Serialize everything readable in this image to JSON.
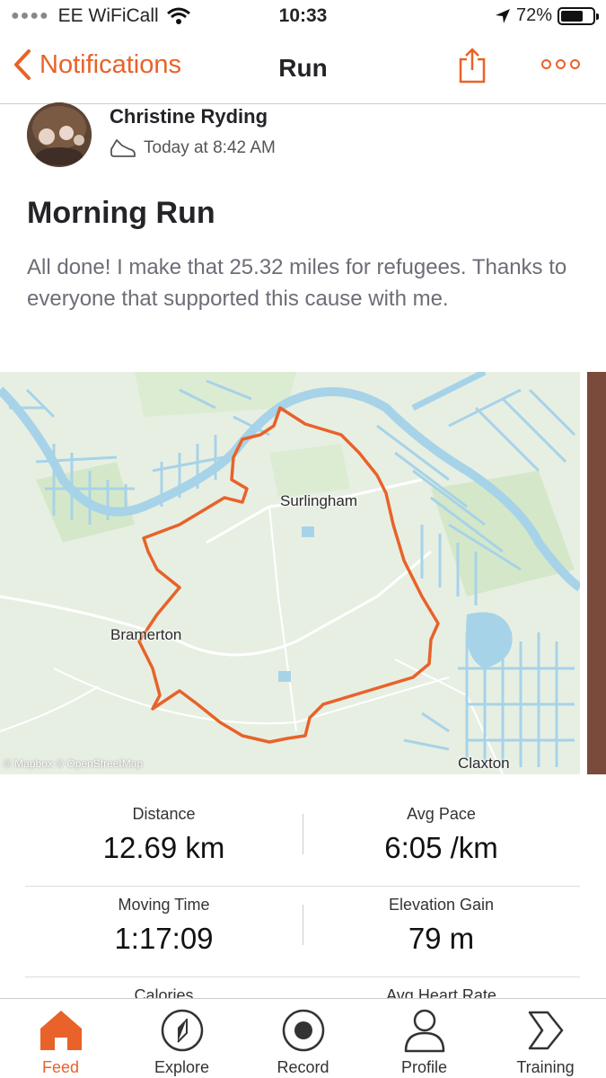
{
  "status": {
    "carrier": "EE WiFiCall",
    "time": "10:33",
    "battery": "72%",
    "battery_level": 0.72
  },
  "nav": {
    "back_label": "Notifications",
    "title": "Run"
  },
  "activity": {
    "athlete": "Christine Ryding",
    "timestamp": "Today at 8:42 AM",
    "title": "Morning Run",
    "description": "All done! I make that 25.32 miles for refugees. Thanks to everyone that supported this cause with me."
  },
  "map": {
    "places": [
      "Surlingham",
      "Bramerton",
      "Claxton"
    ],
    "attribution": "© Mapbox © OpenStreetMap",
    "route_color": "#e8622a"
  },
  "stats": [
    {
      "label": "Distance",
      "value": "12.69 km"
    },
    {
      "label": "Avg Pace",
      "value": "6:05 /km"
    },
    {
      "label": "Moving Time",
      "value": "1:17:09"
    },
    {
      "label": "Elevation Gain",
      "value": "79 m"
    },
    {
      "label": "Calories",
      "value": ""
    },
    {
      "label": "Avg Heart Rate",
      "value": ""
    }
  ],
  "tabs": [
    {
      "label": "Feed",
      "icon": "home-icon"
    },
    {
      "label": "Explore",
      "icon": "compass-icon"
    },
    {
      "label": "Record",
      "icon": "record-icon"
    },
    {
      "label": "Profile",
      "icon": "person-icon"
    },
    {
      "label": "Training",
      "icon": "training-icon"
    }
  ],
  "colors": {
    "accent": "#e8622a",
    "text": "#242428",
    "muted": "#6d6d78",
    "water": "#a7d3e8"
  }
}
